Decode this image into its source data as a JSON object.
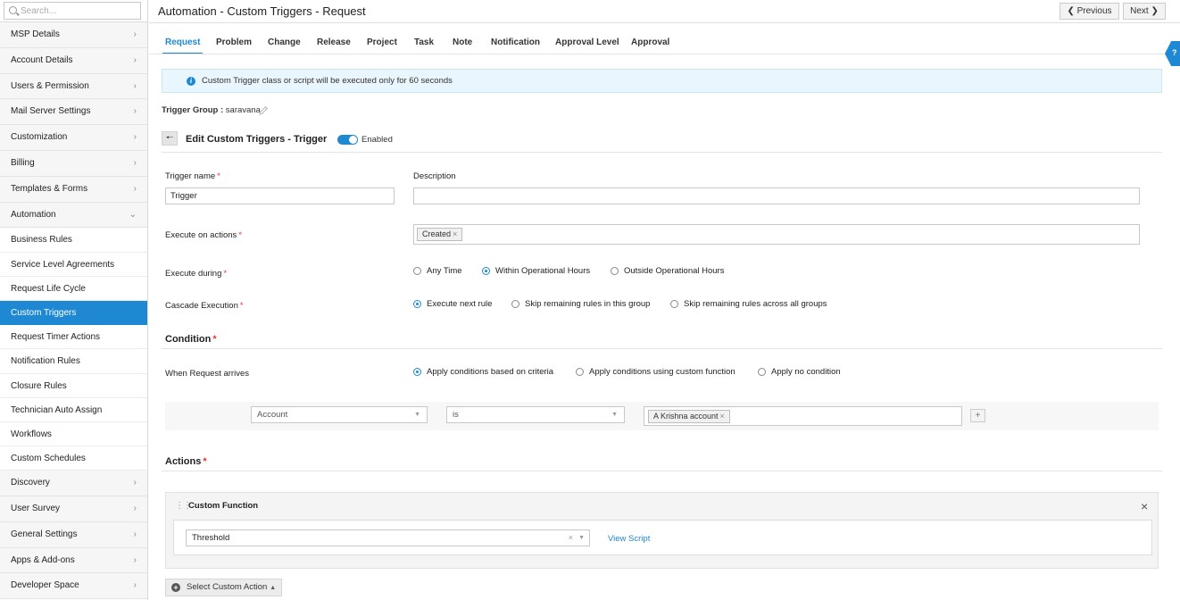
{
  "sidebar": {
    "search_placeholder": "Search...",
    "items_top": [
      {
        "label": "MSP Details"
      },
      {
        "label": "Account Details"
      },
      {
        "label": "Users & Permission"
      },
      {
        "label": "Mail Server Settings"
      },
      {
        "label": "Customization"
      },
      {
        "label": "Billing"
      },
      {
        "label": "Templates & Forms"
      },
      {
        "label": "Automation"
      }
    ],
    "sub_items": [
      {
        "label": "Business Rules"
      },
      {
        "label": "Service Level Agreements"
      },
      {
        "label": "Request Life Cycle"
      },
      {
        "label": "Custom Triggers"
      },
      {
        "label": "Request Timer Actions"
      },
      {
        "label": "Notification Rules"
      },
      {
        "label": "Closure Rules"
      },
      {
        "label": "Technician Auto Assign"
      },
      {
        "label": "Workflows"
      },
      {
        "label": "Custom Schedules"
      }
    ],
    "items_bottom": [
      {
        "label": "Discovery"
      },
      {
        "label": "User Survey"
      },
      {
        "label": "General Settings"
      },
      {
        "label": "Apps & Add-ons"
      },
      {
        "label": "Developer Space"
      }
    ]
  },
  "header": {
    "title": "Automation - Custom Triggers - Request",
    "prev_label": "Previous",
    "next_label": "Next"
  },
  "tabs": [
    "Request",
    "Problem",
    "Change",
    "Release",
    "Project",
    "Task",
    "Note",
    "Notification",
    "Approval Level",
    "Approval"
  ],
  "active_tab": "Request",
  "info_banner": "Custom Trigger class or script will be executed only for 60 seconds",
  "trigger_group": {
    "label": "Trigger Group :",
    "value": "saravana"
  },
  "edit": {
    "title": "Edit Custom Triggers - Trigger",
    "toggle_label": "Enabled",
    "enabled": true
  },
  "form": {
    "trigger_name_label": "Trigger name",
    "trigger_name_value": "Trigger",
    "description_label": "Description",
    "description_value": "",
    "execute_on_label": "Execute on actions",
    "execute_on_chip": "Created",
    "execute_during_label": "Execute during",
    "execute_during_options": [
      "Any Time",
      "Within Operational Hours",
      "Outside Operational Hours"
    ],
    "execute_during_selected": "Within Operational Hours",
    "cascade_label": "Cascade Execution",
    "cascade_options": [
      "Execute next rule",
      "Skip remaining rules in this group",
      "Skip remaining rules across all groups"
    ],
    "cascade_selected": "Execute next rule"
  },
  "condition": {
    "title": "Condition",
    "when_label": "When Request arrives",
    "options": [
      "Apply conditions based on criteria",
      "Apply conditions using custom function",
      "Apply no condition"
    ],
    "selected": "Apply conditions based on criteria",
    "criteria": {
      "field": "Account",
      "operator": "is",
      "value_chip": "A Krishna account"
    }
  },
  "actions": {
    "title": "Actions",
    "panel_title": "Custom Function",
    "function_value": "Threshold",
    "view_script": "View Script",
    "select_custom_action": "Select Custom Action"
  },
  "colors": {
    "accent": "#1e88d2",
    "required": "#e53935",
    "banner_bg": "#e9f6fd"
  }
}
